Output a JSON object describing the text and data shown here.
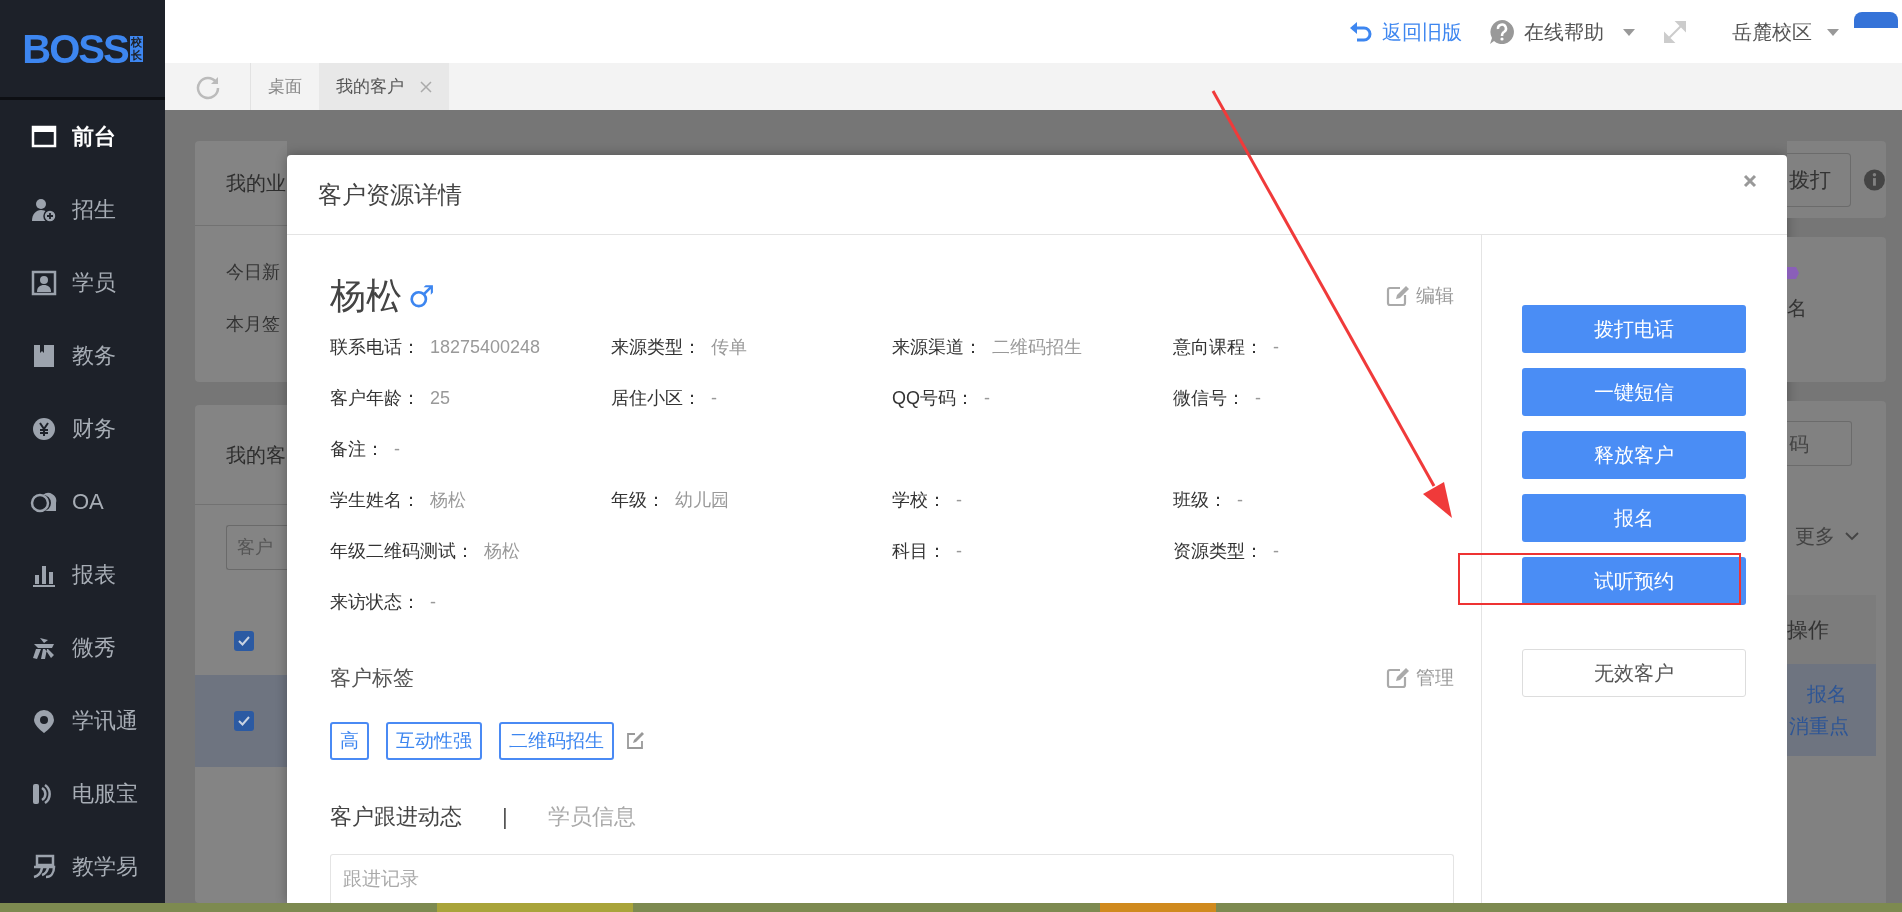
{
  "logo": {
    "text": "BOSS",
    "badge": "校长"
  },
  "header": {
    "links": [
      {
        "kind": "back",
        "label": "返回旧版"
      },
      {
        "kind": "help",
        "label": "在线帮助"
      }
    ],
    "campus": "岳麓校区"
  },
  "sidebar": {
    "items": [
      {
        "label": "前台",
        "selected": true
      },
      {
        "label": "招生",
        "selected": false
      },
      {
        "label": "学员",
        "selected": false
      },
      {
        "label": "教务",
        "selected": false
      },
      {
        "label": "财务",
        "selected": false
      },
      {
        "label": "OA",
        "selected": false
      },
      {
        "label": "报表",
        "selected": false
      },
      {
        "label": "微秀",
        "selected": false
      },
      {
        "label": "学讯通",
        "selected": false
      },
      {
        "label": "电服宝",
        "selected": false
      },
      {
        "label": "教学易",
        "selected": false
      }
    ]
  },
  "tabs": [
    {
      "label": "桌面",
      "selected": false,
      "closable": false
    },
    {
      "label": "我的客户",
      "selected": true,
      "closable": true
    }
  ],
  "background": {
    "left": {
      "card_title": "我的业",
      "stats": [
        "今日新",
        "本月签"
      ],
      "list_title": "我的客",
      "search_placeholder": "客户",
      "header_checked": true,
      "rows": [
        {
          "checked": true,
          "selected": true
        }
      ]
    },
    "right": {
      "dial_button": "拨打",
      "stat_label": "名",
      "field_placeholder": "码",
      "more": "更多",
      "column": "操作",
      "row_actions": [
        "报名",
        "消重点"
      ]
    }
  },
  "modal": {
    "title": "客户资源详情",
    "name": "杨松",
    "gender": "♂",
    "edit": "编辑",
    "field_rows": [
      [
        {
          "label": "联系电话：",
          "value": "18275400248",
          "wide": false
        },
        {
          "label": "来源类型：",
          "value": "传单",
          "wide": false
        },
        {
          "label": "来源渠道：",
          "value": "二维码招生",
          "wide": false
        },
        {
          "label": "意向课程：",
          "value": "-",
          "wide": false
        }
      ],
      [
        {
          "label": "客户年龄：",
          "value": "25",
          "wide": false
        },
        {
          "label": "居住小区：",
          "value": "-",
          "wide": false
        },
        {
          "label": "QQ号码：",
          "value": "-",
          "wide": false
        },
        {
          "label": "微信号：",
          "value": "-",
          "wide": false
        }
      ],
      [
        {
          "label": "备注：",
          "value": "-",
          "wide": false
        }
      ],
      [
        {
          "label": "学生姓名：",
          "value": "杨松",
          "wide": false
        },
        {
          "label": "年级：",
          "value": "幼儿园",
          "wide": false
        },
        {
          "label": "学校：",
          "value": "-",
          "wide": false
        },
        {
          "label": "班级：",
          "value": "-",
          "wide": false
        }
      ],
      [
        {
          "label": "年级二维码测试：",
          "value": "杨松",
          "wide": true
        },
        {
          "label": "科目：",
          "value": "-",
          "wide": false
        },
        {
          "label": "资源类型：",
          "value": "-",
          "wide": false
        }
      ],
      [
        {
          "label": "来访状态：",
          "value": "-",
          "wide": false
        }
      ]
    ],
    "tags_title": "客户标签",
    "manage": "管理",
    "tags": [
      "高",
      "互动性强",
      "二维码招生"
    ],
    "sections": [
      {
        "label": "客户跟进动态",
        "selected": true
      },
      {
        "label": "学员信息",
        "selected": false
      }
    ],
    "separator": "|",
    "record_placeholder": "跟进记录",
    "actions": [
      {
        "label": "拨打电话",
        "kind": "primary",
        "highlighted": false
      },
      {
        "label": "一键短信",
        "kind": "primary",
        "highlighted": false
      },
      {
        "label": "释放客户",
        "kind": "primary",
        "highlighted": false
      },
      {
        "label": "报名",
        "kind": "primary",
        "highlighted": false
      },
      {
        "label": "试听预约",
        "kind": "primary",
        "highlighted": true
      },
      {
        "label": "无效客户",
        "kind": "default",
        "highlighted": false
      }
    ]
  }
}
